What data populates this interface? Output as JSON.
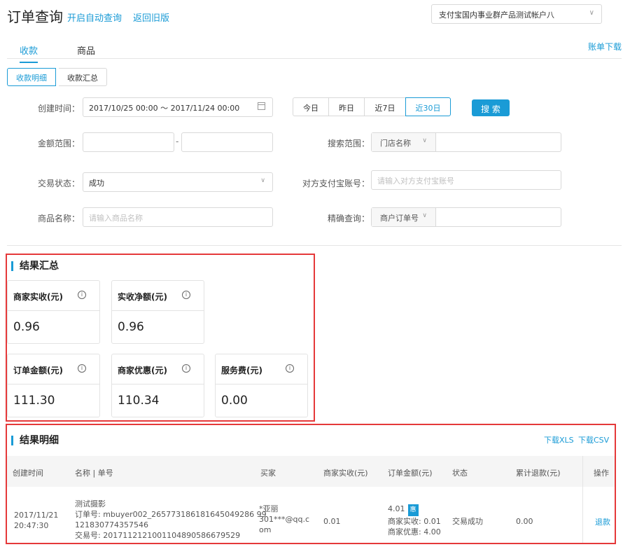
{
  "header": {
    "title": "订单查询",
    "auto_query_link": "开启自动查询",
    "old_version_link": "返回旧版",
    "account_select": "支付宝国内事业群产品测试帐户八"
  },
  "tabs": [
    "收款",
    "商品"
  ],
  "bill_download": "账单下载",
  "segments": [
    "收款明细",
    "收款汇总"
  ],
  "filters": {
    "created_time_label": "创建时间：",
    "created_time_value": "2017/10/25 00:00 ～ 2017/11/24 00:00",
    "quick_ranges": [
      "今日",
      "昨日",
      "近7日",
      "近30日"
    ],
    "search_button": "搜 索",
    "amount_range_label": "金额范围：",
    "amount_sep": "-",
    "search_scope_label": "搜索范围：",
    "search_scope_option": "门店名称",
    "trade_status_label": "交易状态：",
    "trade_status_value": "成功",
    "counterpart_label": "对方支付宝账号：",
    "counterpart_placeholder": "请输入对方支付宝账号",
    "product_name_label": "商品名称：",
    "product_name_placeholder": "请输入商品名称",
    "exact_query_label": "精确查询：",
    "exact_query_option": "商户订单号"
  },
  "summary": {
    "title": "结果汇总",
    "cards": [
      {
        "label": "商家实收(元)",
        "value": "0.96"
      },
      {
        "label": "实收净额(元)",
        "value": "0.96"
      },
      {
        "label": "订单金额(元)",
        "value": "111.30"
      },
      {
        "label": "商家优惠(元)",
        "value": "110.34"
      },
      {
        "label": "服务费(元)",
        "value": "0.00"
      }
    ]
  },
  "details": {
    "title": "结果明细",
    "download_xls": "下载XLS",
    "download_csv": "下载CSV",
    "columns": [
      "创建时间",
      "名称 | 单号",
      "买家",
      "商家实收(元)",
      "订单金额(元)",
      "状态",
      "累计退款(元)",
      "操作"
    ],
    "row": {
      "date": "2017/11/21",
      "time": "20:47:30",
      "name": "测试摄影",
      "order_no_1": "订单号: mbuyer002_265773186181645049286 99",
      "order_no_2": "121830774357546",
      "trade_no": "交易号: 2017112121001104890586679529",
      "buyer_1": "*亚丽",
      "buyer_2": "301***@qq.c",
      "buyer_3": "om",
      "merchant_received": "0.01",
      "order_amount": "4.01",
      "discount_badge": "惠",
      "merchant_received_line": "商家实收: 0.01",
      "merchant_discount_line": "商家优惠: 4.00",
      "status": "交易成功",
      "refunded": "0.00",
      "action": "退款"
    }
  }
}
